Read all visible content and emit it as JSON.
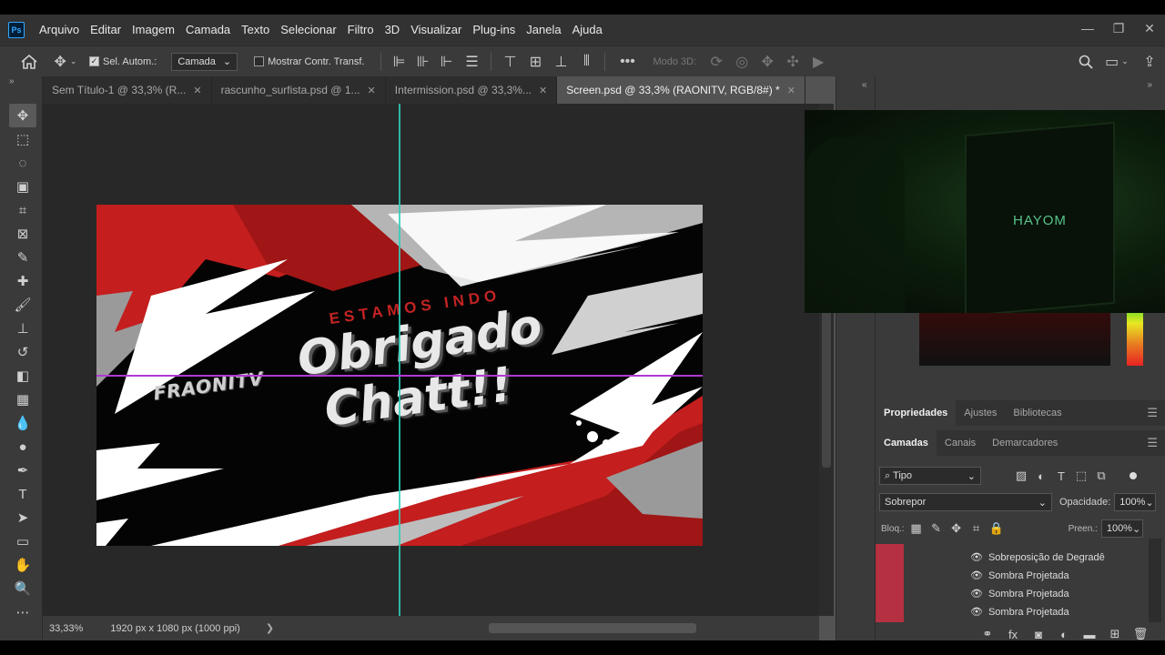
{
  "app": {
    "logo": "Ps"
  },
  "menu": [
    "Arquivo",
    "Editar",
    "Imagem",
    "Camada",
    "Texto",
    "Selecionar",
    "Filtro",
    "3D",
    "Visualizar",
    "Plug-ins",
    "Janela",
    "Ajuda"
  ],
  "window_controls": {
    "minimize": "—",
    "restore": "❐",
    "close": "✕"
  },
  "options": {
    "auto_select_label": "Sel. Autom.:",
    "auto_select_target": "Camada",
    "show_transform_label": "Mostrar Contr. Transf.",
    "more": "•••",
    "mode3d_label": "Modo 3D:"
  },
  "tabs": [
    {
      "label": "Sem Título-1 @ 33,3% (R...",
      "active": false
    },
    {
      "label": "rascunho_surfista.psd @ 1...",
      "active": false
    },
    {
      "label": "Intermission.psd @ 33,3%...",
      "active": false
    },
    {
      "label": "Screen.psd @ 33,3% (RAONITV, RGB/8#) *",
      "active": true
    }
  ],
  "tab_close": "✕",
  "artwork": {
    "line1": "ESTAMOS INDO",
    "line2": "Obrigado",
    "line3": "Chatt!!",
    "brand": "FRAONITV"
  },
  "status": {
    "zoom": "33,33%",
    "doc_info": "1920 px x 1080 px (1000 ppi)",
    "arrow": "❯"
  },
  "panels": {
    "top_tabs": [
      "Propriedades",
      "Ajustes",
      "Bibliotecas"
    ],
    "layer_tabs": [
      "Camadas",
      "Canais",
      "Demarcadores"
    ],
    "filter_kind": "Tipo",
    "blend_mode": "Sobrepor",
    "opacity_label": "Opacidade:",
    "opacity_value": "100%",
    "lock_label": "Bloq.:",
    "fill_label": "Preen.:",
    "fill_value": "100%",
    "effects": [
      "Sobreposição de Degradê",
      "Sombra Projetada",
      "Sombra Projetada",
      "Sombra Projetada"
    ]
  },
  "webcam": {
    "brand_text": "HAYOM"
  },
  "colors": {
    "accent_red": "#c42323",
    "guide_cyan": "#2fd0b8",
    "guide_magenta": "#b03ad0",
    "panel_bg": "#3a3a3a",
    "canvas_bg": "#282828"
  }
}
